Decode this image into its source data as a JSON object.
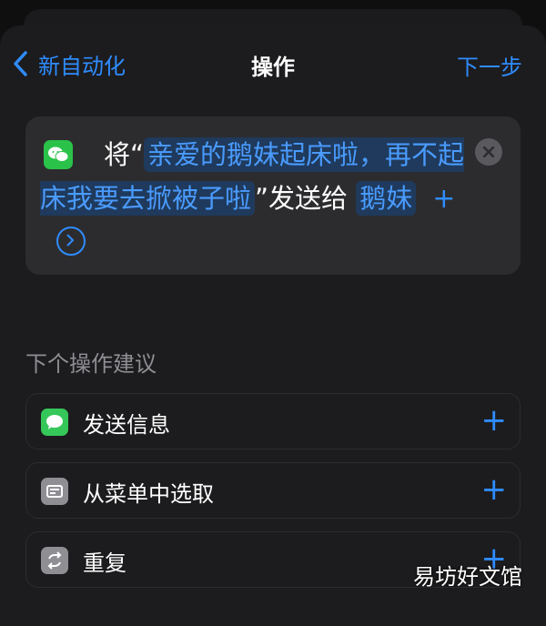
{
  "nav": {
    "back_label": "新自动化",
    "title": "操作",
    "next_label": "下一步"
  },
  "action": {
    "prefix": "将“",
    "message_token": "亲爱的鹅妹起床啦，再不起床我要去掀被子啦",
    "middle": "”发送给",
    "recipient_token": "鹅妹",
    "add_symbol": "+"
  },
  "suggestions": {
    "header": "下个操作建议",
    "items": [
      {
        "label": "发送信息",
        "icon": "messages-icon"
      },
      {
        "label": "从菜单中选取",
        "icon": "menu-icon"
      },
      {
        "label": "重复",
        "icon": "repeat-icon"
      }
    ],
    "add_symbol": "+"
  },
  "watermark": "易坊好文馆",
  "colors": {
    "accent": "#2f8cff",
    "background": "#1c1c1e",
    "card": "#2c2c2e"
  }
}
